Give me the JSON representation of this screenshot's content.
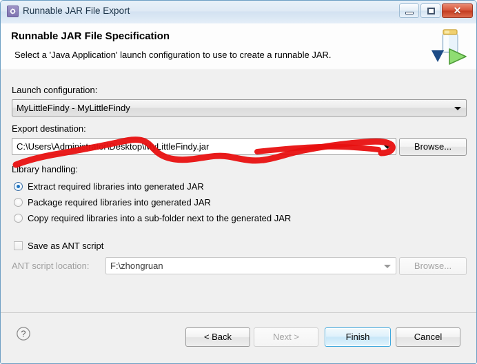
{
  "window": {
    "title": "Runnable JAR File Export",
    "icon": "gear-icon",
    "controls": {
      "minimize": "minimize-button",
      "maximize": "maximize-button",
      "close_glyph": "✕"
    }
  },
  "header": {
    "title": "Runnable JAR File Specification",
    "description": "Select a 'Java Application' launch configuration to use to create a runnable JAR.",
    "icon": "jar-export-icon"
  },
  "form": {
    "launch_configuration": {
      "label": "Launch configuration:",
      "value": "MyLittleFindy - MyLittleFindy"
    },
    "export_destination": {
      "label": "Export destination:",
      "value": "C:\\Users\\Administrator\\Desktop\\MyLittleFindy.jar",
      "browse_label": "Browse..."
    },
    "library_handling": {
      "label": "Library handling:",
      "options": [
        {
          "label": "Extract required libraries into generated JAR",
          "selected": true
        },
        {
          "label": "Package required libraries into generated JAR",
          "selected": false
        },
        {
          "label": "Copy required libraries into a sub-folder next to the generated JAR",
          "selected": false
        }
      ]
    },
    "save_as_ant": {
      "label": "Save as ANT script",
      "checked": false
    },
    "ant_script_location": {
      "label": "ANT script location:",
      "value": "F:\\zhongruan",
      "browse_label": "Browse...",
      "enabled": false
    }
  },
  "footer": {
    "help_glyph": "?",
    "buttons": [
      {
        "label": "< Back",
        "state": "enabled"
      },
      {
        "label": "Next >",
        "state": "disabled"
      },
      {
        "label": "Finish",
        "state": "default"
      },
      {
        "label": "Cancel",
        "state": "enabled"
      }
    ]
  },
  "annotation": {
    "type": "red-underline-scribble",
    "color": "#e81010"
  },
  "colors": {
    "titlebar": "#dfeaf5",
    "header_bg": "#fdfdfd",
    "body_bg": "#f0f0f0",
    "accent": "#3fa8dd",
    "annotation_red": "#e81010"
  }
}
